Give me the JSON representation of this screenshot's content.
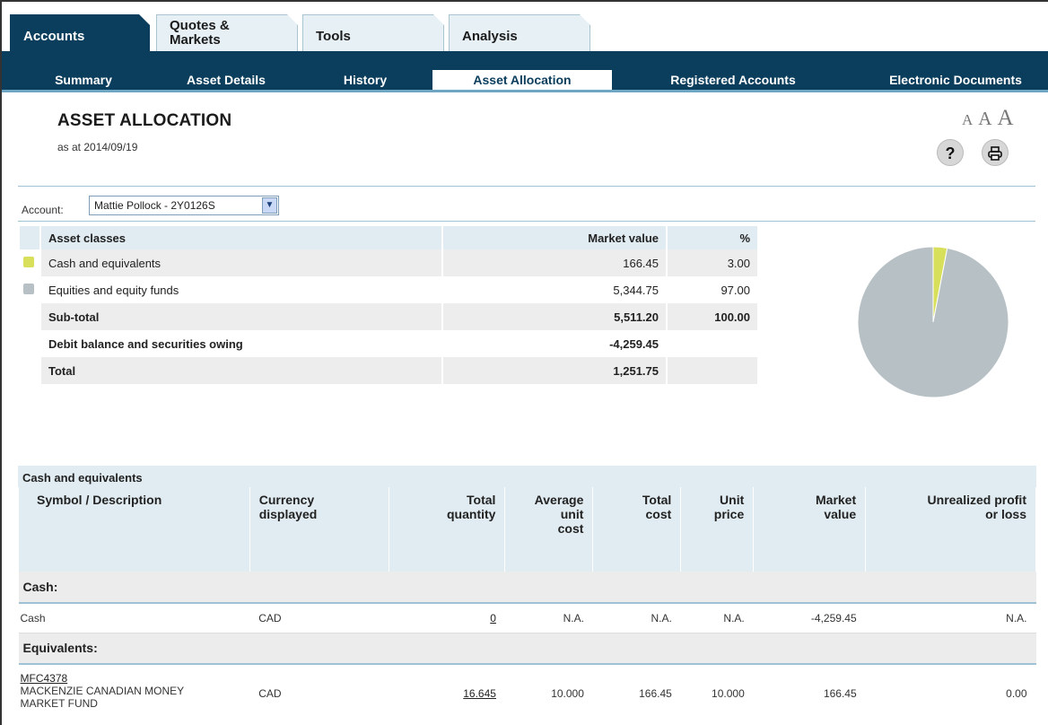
{
  "tabs": [
    {
      "label": "Accounts",
      "active": true
    },
    {
      "label": "Quotes & Markets",
      "active": false
    },
    {
      "label": "Tools",
      "active": false
    },
    {
      "label": "Analysis",
      "active": false
    }
  ],
  "subnav": [
    {
      "label": "Summary",
      "active": false
    },
    {
      "label": "Asset Details",
      "active": false
    },
    {
      "label": "History",
      "active": false
    },
    {
      "label": "Asset Allocation",
      "active": true
    },
    {
      "label": "Registered Accounts",
      "active": false
    },
    {
      "label": "Electronic Documents",
      "active": false
    }
  ],
  "header": {
    "title": "ASSET ALLOCATION",
    "as_at": "as at 2014/09/19",
    "font_sizes": [
      "A",
      "A",
      "A"
    ],
    "help_icon": "question-mark-icon",
    "print_icon": "printer-icon"
  },
  "account": {
    "label": "Account:",
    "selected": "Mattie Pollock - 2Y0126S"
  },
  "summary": {
    "headers": {
      "asset_classes": "Asset classes",
      "market_value": "Market value",
      "percent": "%"
    },
    "rows": [
      {
        "name": "Cash and equivalents",
        "market_value": "166.45",
        "percent": "3.00",
        "color": "#d8df5a"
      },
      {
        "name": "Equities and equity funds",
        "market_value": "5,344.75",
        "percent": "97.00",
        "color": "#b7c0c5"
      }
    ],
    "subtotal": {
      "label": "Sub-total",
      "market_value": "5,511.20",
      "percent": "100.00"
    },
    "debit": {
      "label": "Debit balance and securities owing",
      "market_value": "-4,259.45"
    },
    "total": {
      "label": "Total",
      "market_value": "1,251.75"
    }
  },
  "chart_data": {
    "type": "pie",
    "categories": [
      "Cash and equivalents",
      "Equities and equity funds"
    ],
    "values": [
      3.0,
      97.0
    ],
    "colors": [
      "#d8df5a",
      "#b7c0c5"
    ]
  },
  "detail": {
    "section_title": "Cash and equivalents",
    "columns": {
      "symbol": "Symbol / Description",
      "currency_1": "Currency",
      "currency_2": "displayed",
      "qty_1": "Total",
      "qty_2": "quantity",
      "avg_1": "Average",
      "avg_2": "unit",
      "avg_3": "cost",
      "cost_1": "Total",
      "cost_2": "cost",
      "unit_1": "Unit",
      "unit_2": "price",
      "mv_1": "Market",
      "mv_2": "value",
      "upl_1": "Unrealized profit",
      "upl_2": "or loss"
    },
    "groups": {
      "cash": "Cash:",
      "equivalents": "Equivalents:"
    },
    "cash_row": {
      "description": "Cash",
      "currency": "CAD",
      "quantity": "0",
      "avg_cost": "N.A.",
      "total_cost": "N.A.",
      "unit_price": "N.A.",
      "market_value": "-4,259.45",
      "unrealized": "N.A."
    },
    "fund_row": {
      "symbol": "MFC4378",
      "description_1": "MACKENZIE CANADIAN MONEY",
      "description_2": "MARKET FUND",
      "currency": "CAD",
      "quantity": "16.645",
      "avg_cost": "10.000",
      "total_cost": "166.45",
      "unit_price": "10.000",
      "market_value": "166.45",
      "unrealized": "0.00"
    }
  }
}
